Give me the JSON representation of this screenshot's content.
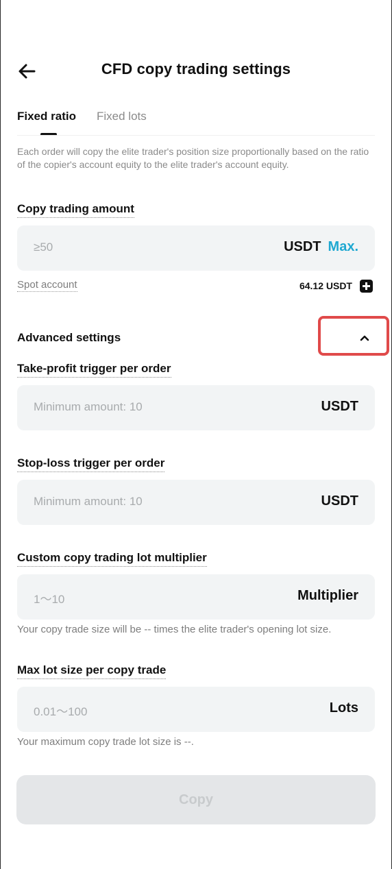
{
  "header": {
    "title": "CFD copy trading settings"
  },
  "tabs": [
    {
      "label": "Fixed ratio",
      "active": true
    },
    {
      "label": "Fixed lots",
      "active": false
    }
  ],
  "description": "Each order will copy the elite trader's position size proportionally based on the ratio of the copier's account equity to the elite trader's account equity.",
  "copy_amount": {
    "label": "Copy trading amount",
    "placeholder": "≥50",
    "unit": "USDT",
    "max_label": "Max."
  },
  "spot_account": {
    "label": "Spot account",
    "value": "64.12 USDT"
  },
  "advanced": {
    "label": "Advanced settings",
    "expanded": true
  },
  "take_profit": {
    "label": "Take-profit trigger per order",
    "placeholder": "Minimum amount: 10",
    "unit": "USDT"
  },
  "stop_loss": {
    "label": "Stop-loss trigger per order",
    "placeholder": "Minimum amount: 10",
    "unit": "USDT"
  },
  "multiplier": {
    "label": "Custom copy trading lot multiplier",
    "placeholder": "1～10",
    "unit": "Multiplier",
    "hint": "Your copy trade size will be -- times the elite trader's opening lot size."
  },
  "max_lot": {
    "label": "Max lot size per copy trade",
    "placeholder": "0.01～100",
    "unit": "Lots",
    "hint": "Your maximum copy trade lot size is --."
  },
  "copy_button": {
    "label": "Copy"
  },
  "colors": {
    "accent": "#1fa8d1",
    "highlight_box": "#e04a4a",
    "input_bg": "#f2f4f5",
    "disabled_btn": "#e4e6e8"
  }
}
